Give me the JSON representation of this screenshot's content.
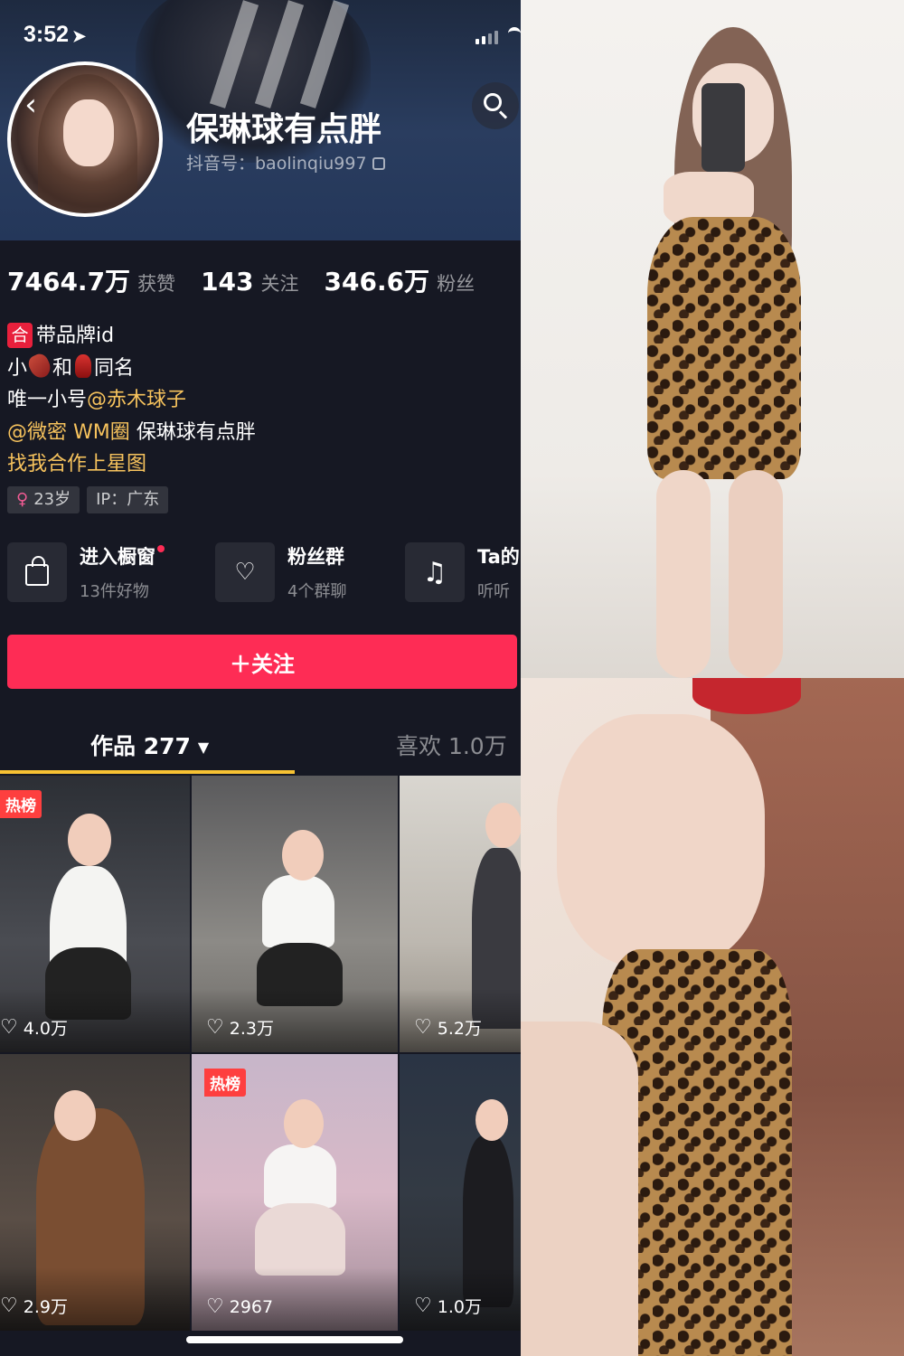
{
  "status_bar": {
    "time": "3:52"
  },
  "profile": {
    "nickname": "保琳球有点胖",
    "douyin_id": "抖音号：baolinqiu997"
  },
  "stats": [
    {
      "value": "7464.7万",
      "label": "获赞"
    },
    {
      "value": "143",
      "label": "关注"
    },
    {
      "value": "346.6万",
      "label": "粉丝"
    }
  ],
  "bio": {
    "line1_badge": "合",
    "line1_text": "带品牌id",
    "line2_a": "小",
    "line2_b": "和",
    "line2_c": "同名",
    "line3_text": "唯一小号",
    "line3_link": "@赤木球子",
    "line4_link": "@微密 WM圈",
    "line4_text": " 保琳球有点胖",
    "line5_link": "找我合作上星图"
  },
  "tags": {
    "age": "23岁",
    "ip": "IP：广东"
  },
  "entries": [
    {
      "title": "进入橱窗",
      "subtitle": "13件好物",
      "icon": "shopping-bag-icon"
    },
    {
      "title": "粉丝群",
      "subtitle": "4个群聊",
      "icon": "fan-group-icon"
    },
    {
      "title": "Ta的",
      "subtitle": "听听",
      "icon": "music-note-icon"
    }
  ],
  "follow_button": "＋关注",
  "tabs": {
    "works": "作品 277",
    "likes": "喜欢 1.0万"
  },
  "videos": [
    {
      "likes": "4.0万",
      "badge": "热榜"
    },
    {
      "likes": "2.3万",
      "badge": ""
    },
    {
      "likes": "5.2万",
      "badge": ""
    },
    {
      "likes": "2.9万",
      "badge": ""
    },
    {
      "likes": "2967",
      "badge": "热榜"
    },
    {
      "likes": "1.0万",
      "badge": ""
    }
  ],
  "colors": {
    "accent": "#fe2c55",
    "link": "#f7c35d",
    "background": "#161823",
    "tab_indicator": "#f7c233"
  }
}
